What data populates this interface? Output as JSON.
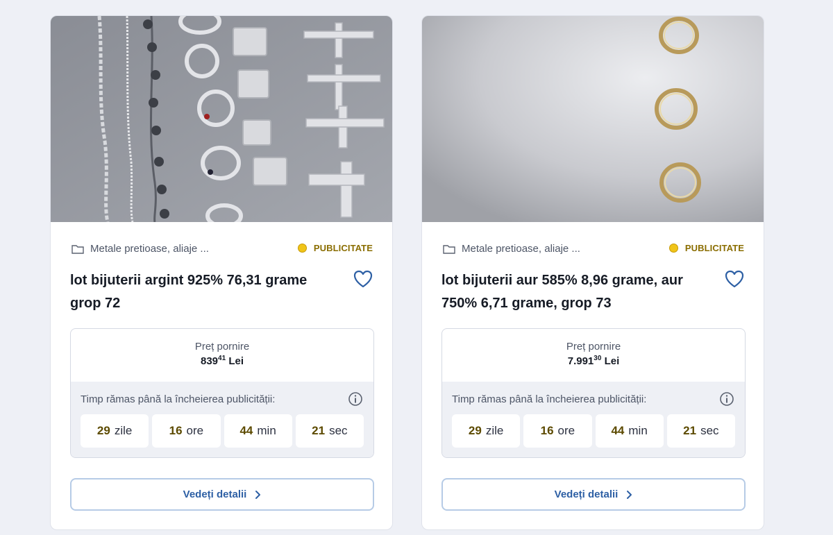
{
  "cards": [
    {
      "category": "Metale pretioase, aliaje ...",
      "badge": "PUBLICITATE",
      "title": "lot bijuterii argint 925% 76,31 grame grop 72",
      "price_label": "Preț pornire",
      "price_int": "839",
      "price_dec": "41",
      "price_currency": "Lei",
      "time_label": "Timp rămas până la încheierea publicității:",
      "countdown": [
        {
          "num": "29",
          "unit": "zile"
        },
        {
          "num": "16",
          "unit": "ore"
        },
        {
          "num": "44",
          "unit": "min"
        },
        {
          "num": "21",
          "unit": "sec"
        }
      ],
      "details_label": "Vedeți detalii",
      "photo_icon": "silver-jewelry-photo"
    },
    {
      "category": "Metale pretioase, aliaje ...",
      "badge": "PUBLICITATE",
      "title": "lot bijuterii aur 585% 8,96 grame, aur 750% 6,71 grame, grop 73",
      "price_label": "Preț pornire",
      "price_int": "7.991",
      "price_dec": "30",
      "price_currency": "Lei",
      "time_label": "Timp rămas până la încheierea publicității:",
      "countdown": [
        {
          "num": "29",
          "unit": "zile"
        },
        {
          "num": "16",
          "unit": "ore"
        },
        {
          "num": "44",
          "unit": "min"
        },
        {
          "num": "21",
          "unit": "sec"
        }
      ],
      "details_label": "Vedeți detalii",
      "photo_icon": "gold-rings-photo"
    }
  ],
  "colors": {
    "accent_blue": "#2d5fa4",
    "badge_yellow": "#f0c419",
    "page_bg": "#eef0f6"
  }
}
